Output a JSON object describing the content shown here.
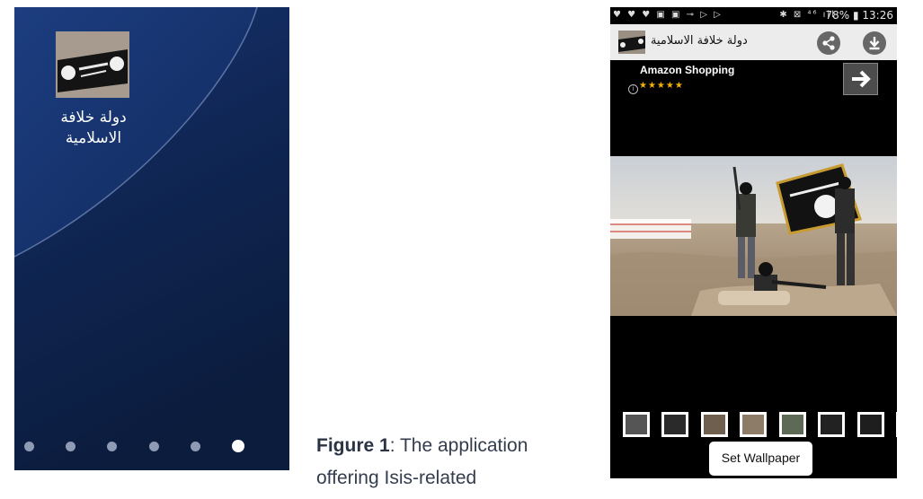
{
  "home_screen": {
    "app_label_line1": "دولة خلافة",
    "app_label_line2": "الاسلامية",
    "page_dots": 6,
    "active_dot": 6
  },
  "caption": {
    "figure_label": "Figure 1",
    "line1_rest": ": The application",
    "line2": "offering Isis-related"
  },
  "app": {
    "status_bar": {
      "battery": "78%",
      "time": "13:26"
    },
    "title": "دولة خلافة الاسلامية",
    "icons": {
      "share": "share-icon",
      "download": "download-icon"
    },
    "ad": {
      "title": "Amazon Shopping",
      "stars": "★★★★★",
      "rating": 4.5
    },
    "set_wallpaper_label": "Set Wallpaper",
    "thumbnail_count": 8
  },
  "colors": {
    "home_bg": "#0d2148",
    "app_bg": "#000000",
    "titlebar_bg": "#ececec",
    "icon_button": "#676767",
    "star": "#f2b300"
  }
}
